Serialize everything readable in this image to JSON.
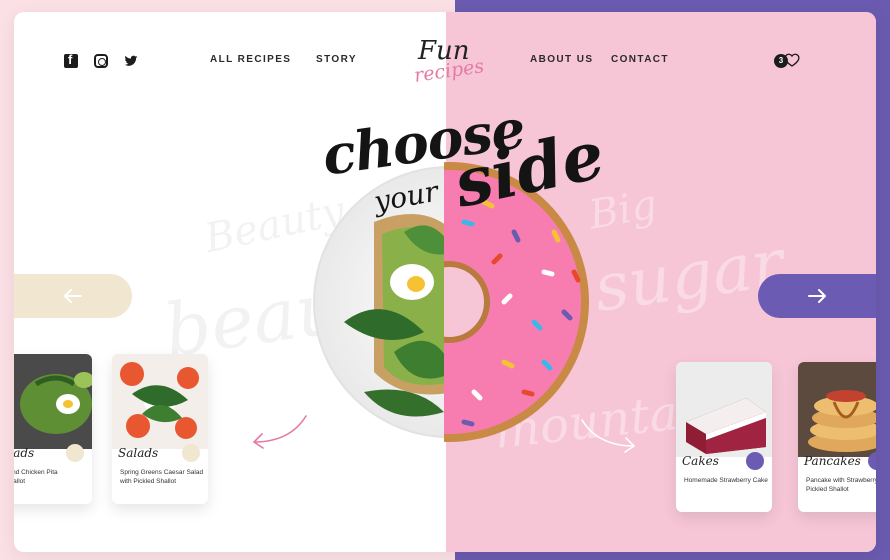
{
  "nav": {
    "social": [
      "facebook-icon",
      "instagram-icon",
      "twitter-icon"
    ],
    "links": {
      "all_recipes": "ALL RECIPES",
      "story": "STORY",
      "about_us": "ABOUT US",
      "contact": "CONTACT"
    },
    "logo": {
      "top": "Fun",
      "bottom": "recipes"
    },
    "favorites_count": "3"
  },
  "hero": {
    "choose": "choose",
    "your": "your",
    "side": "side"
  },
  "ghost": {
    "left_1": "Beauty",
    "left_2": "beauty",
    "right_1": "Big",
    "right_2": "sugar",
    "right_3": "mountain"
  },
  "cards_left": [
    {
      "category": "Salads",
      "title": "ale and Chicken Pita edShallot"
    },
    {
      "category": "Salads",
      "title": "Spring Greens Caesar Salad with Pickled Shallot"
    }
  ],
  "cards_right": [
    {
      "category": "Cakes",
      "title": "Homemade Strawberry Cake"
    },
    {
      "category": "Pancakes",
      "title": "Pancake with Strawberry Pickled Shallot"
    }
  ],
  "colors": {
    "pink": "#f6c6d7",
    "purple": "#6c5bb3",
    "cream": "#f1e6cf",
    "accent_pink": "#e57aa3"
  }
}
